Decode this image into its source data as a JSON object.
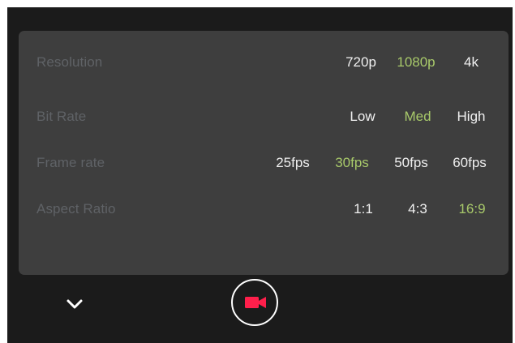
{
  "settings": {
    "resolution": {
      "label": "Resolution",
      "options": [
        "720p",
        "1080p",
        "4k"
      ],
      "selected": "1080p"
    },
    "bit_rate": {
      "label": "Bit Rate",
      "options": [
        "Low",
        "Med",
        "High"
      ],
      "selected": "Med"
    },
    "frame_rate": {
      "label": "Frame rate",
      "options": [
        "25fps",
        "30fps",
        "50fps",
        "60fps"
      ],
      "selected": "30fps"
    },
    "aspect_ratio": {
      "label": "Aspect Ratio",
      "options": [
        "1:1",
        "4:3",
        "16:9"
      ],
      "selected": "16:9"
    }
  },
  "controls": {
    "collapse_icon": "chevron-down-icon",
    "record_icon": "video-camera-icon"
  },
  "colors": {
    "background": "#1b1b1b",
    "panel": "#3e3e3e",
    "label": "#5f6266",
    "option": "#f0f0f0",
    "selected": "#a8c96a",
    "record": "#ff1f4b"
  }
}
